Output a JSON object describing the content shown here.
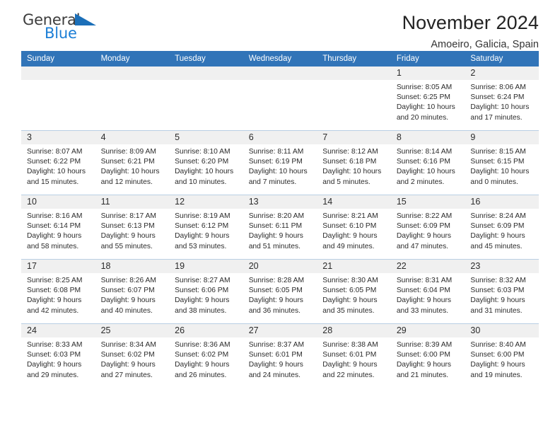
{
  "brand": {
    "name_top": "General",
    "name_bottom": "Blue",
    "accent_color": "#1b7ed6",
    "triangle_icon": "triangle-icon"
  },
  "header": {
    "title": "November 2024",
    "subtitle": "Amoeiro, Galicia, Spain"
  },
  "theme": {
    "header_blue": "#3174b8",
    "daynum_band": "#f0f0f0",
    "row_divider": "#b9cfe4"
  },
  "calendar": {
    "weekday_headers": [
      "Sunday",
      "Monday",
      "Tuesday",
      "Wednesday",
      "Thursday",
      "Friday",
      "Saturday"
    ],
    "weeks": [
      [
        {
          "day": "",
          "lines": []
        },
        {
          "day": "",
          "lines": []
        },
        {
          "day": "",
          "lines": []
        },
        {
          "day": "",
          "lines": []
        },
        {
          "day": "",
          "lines": []
        },
        {
          "day": "1",
          "lines": [
            "Sunrise: 8:05 AM",
            "Sunset: 6:25 PM",
            "Daylight: 10 hours and 20 minutes."
          ]
        },
        {
          "day": "2",
          "lines": [
            "Sunrise: 8:06 AM",
            "Sunset: 6:24 PM",
            "Daylight: 10 hours and 17 minutes."
          ]
        }
      ],
      [
        {
          "day": "3",
          "lines": [
            "Sunrise: 8:07 AM",
            "Sunset: 6:22 PM",
            "Daylight: 10 hours and 15 minutes."
          ]
        },
        {
          "day": "4",
          "lines": [
            "Sunrise: 8:09 AM",
            "Sunset: 6:21 PM",
            "Daylight: 10 hours and 12 minutes."
          ]
        },
        {
          "day": "5",
          "lines": [
            "Sunrise: 8:10 AM",
            "Sunset: 6:20 PM",
            "Daylight: 10 hours and 10 minutes."
          ]
        },
        {
          "day": "6",
          "lines": [
            "Sunrise: 8:11 AM",
            "Sunset: 6:19 PM",
            "Daylight: 10 hours and 7 minutes."
          ]
        },
        {
          "day": "7",
          "lines": [
            "Sunrise: 8:12 AM",
            "Sunset: 6:18 PM",
            "Daylight: 10 hours and 5 minutes."
          ]
        },
        {
          "day": "8",
          "lines": [
            "Sunrise: 8:14 AM",
            "Sunset: 6:16 PM",
            "Daylight: 10 hours and 2 minutes."
          ]
        },
        {
          "day": "9",
          "lines": [
            "Sunrise: 8:15 AM",
            "Sunset: 6:15 PM",
            "Daylight: 10 hours and 0 minutes."
          ]
        }
      ],
      [
        {
          "day": "10",
          "lines": [
            "Sunrise: 8:16 AM",
            "Sunset: 6:14 PM",
            "Daylight: 9 hours and 58 minutes."
          ]
        },
        {
          "day": "11",
          "lines": [
            "Sunrise: 8:17 AM",
            "Sunset: 6:13 PM",
            "Daylight: 9 hours and 55 minutes."
          ]
        },
        {
          "day": "12",
          "lines": [
            "Sunrise: 8:19 AM",
            "Sunset: 6:12 PM",
            "Daylight: 9 hours and 53 minutes."
          ]
        },
        {
          "day": "13",
          "lines": [
            "Sunrise: 8:20 AM",
            "Sunset: 6:11 PM",
            "Daylight: 9 hours and 51 minutes."
          ]
        },
        {
          "day": "14",
          "lines": [
            "Sunrise: 8:21 AM",
            "Sunset: 6:10 PM",
            "Daylight: 9 hours and 49 minutes."
          ]
        },
        {
          "day": "15",
          "lines": [
            "Sunrise: 8:22 AM",
            "Sunset: 6:09 PM",
            "Daylight: 9 hours and 47 minutes."
          ]
        },
        {
          "day": "16",
          "lines": [
            "Sunrise: 8:24 AM",
            "Sunset: 6:09 PM",
            "Daylight: 9 hours and 45 minutes."
          ]
        }
      ],
      [
        {
          "day": "17",
          "lines": [
            "Sunrise: 8:25 AM",
            "Sunset: 6:08 PM",
            "Daylight: 9 hours and 42 minutes."
          ]
        },
        {
          "day": "18",
          "lines": [
            "Sunrise: 8:26 AM",
            "Sunset: 6:07 PM",
            "Daylight: 9 hours and 40 minutes."
          ]
        },
        {
          "day": "19",
          "lines": [
            "Sunrise: 8:27 AM",
            "Sunset: 6:06 PM",
            "Daylight: 9 hours and 38 minutes."
          ]
        },
        {
          "day": "20",
          "lines": [
            "Sunrise: 8:28 AM",
            "Sunset: 6:05 PM",
            "Daylight: 9 hours and 36 minutes."
          ]
        },
        {
          "day": "21",
          "lines": [
            "Sunrise: 8:30 AM",
            "Sunset: 6:05 PM",
            "Daylight: 9 hours and 35 minutes."
          ]
        },
        {
          "day": "22",
          "lines": [
            "Sunrise: 8:31 AM",
            "Sunset: 6:04 PM",
            "Daylight: 9 hours and 33 minutes."
          ]
        },
        {
          "day": "23",
          "lines": [
            "Sunrise: 8:32 AM",
            "Sunset: 6:03 PM",
            "Daylight: 9 hours and 31 minutes."
          ]
        }
      ],
      [
        {
          "day": "24",
          "lines": [
            "Sunrise: 8:33 AM",
            "Sunset: 6:03 PM",
            "Daylight: 9 hours and 29 minutes."
          ]
        },
        {
          "day": "25",
          "lines": [
            "Sunrise: 8:34 AM",
            "Sunset: 6:02 PM",
            "Daylight: 9 hours and 27 minutes."
          ]
        },
        {
          "day": "26",
          "lines": [
            "Sunrise: 8:36 AM",
            "Sunset: 6:02 PM",
            "Daylight: 9 hours and 26 minutes."
          ]
        },
        {
          "day": "27",
          "lines": [
            "Sunrise: 8:37 AM",
            "Sunset: 6:01 PM",
            "Daylight: 9 hours and 24 minutes."
          ]
        },
        {
          "day": "28",
          "lines": [
            "Sunrise: 8:38 AM",
            "Sunset: 6:01 PM",
            "Daylight: 9 hours and 22 minutes."
          ]
        },
        {
          "day": "29",
          "lines": [
            "Sunrise: 8:39 AM",
            "Sunset: 6:00 PM",
            "Daylight: 9 hours and 21 minutes."
          ]
        },
        {
          "day": "30",
          "lines": [
            "Sunrise: 8:40 AM",
            "Sunset: 6:00 PM",
            "Daylight: 9 hours and 19 minutes."
          ]
        }
      ]
    ]
  }
}
